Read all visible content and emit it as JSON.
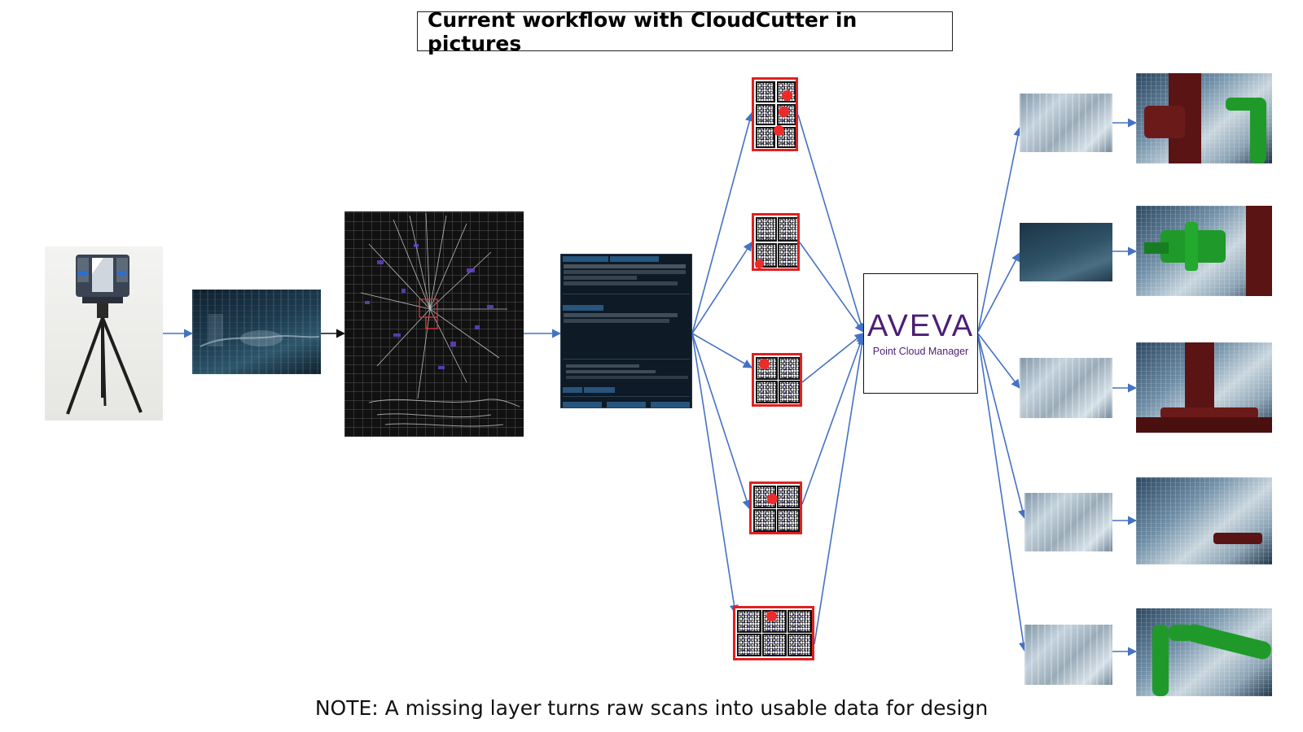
{
  "title": "Current workflow with CloudCutter in pictures",
  "note": "NOTE: A missing layer turns raw scans into usable data for design",
  "colors": {
    "arrow": "#4472c4",
    "arrow_dark": "#111111",
    "tile_border": "#e02020",
    "tile_dot": "#ee2b2b",
    "aveva_purple": "#4a1e75",
    "model_green": "#1f9a2a",
    "model_maroon": "#5a1414"
  },
  "aveva": {
    "brand": "AVEVA",
    "subtitle": "Point Cloud Manager"
  },
  "icons": {
    "scanner": "laser-scanner-on-tripod",
    "aveva": "aveva-logo"
  }
}
